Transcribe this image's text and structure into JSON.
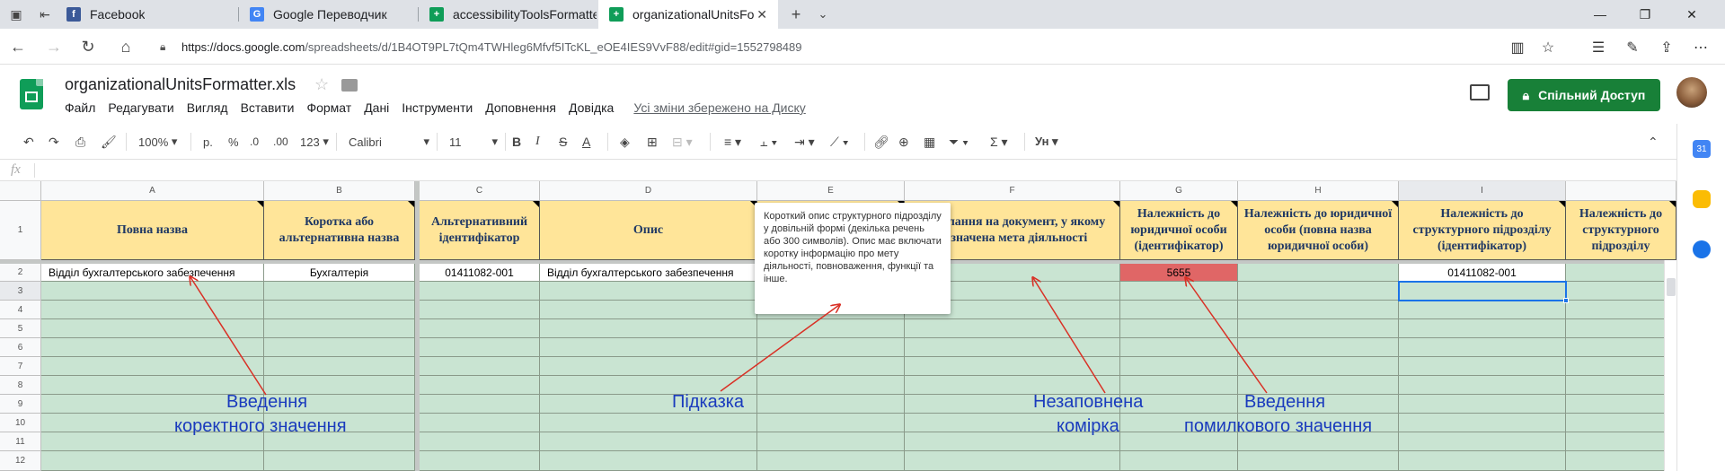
{
  "browser": {
    "tabs": [
      {
        "title": "Facebook",
        "icon": "facebook-icon",
        "color": "#3b5998"
      },
      {
        "title": "Google Переводчик",
        "icon": "google-translate-icon",
        "color": "#4285f4"
      },
      {
        "title": "accessibilityToolsFormatter.x",
        "icon": "sheets-icon",
        "color": "#0f9d58"
      },
      {
        "title": "organizationalUnitsForm",
        "icon": "sheets-icon",
        "color": "#0f9d58"
      }
    ],
    "url_main": "https://docs.google.com",
    "url_rest": "/spreadsheets/d/1B4OT9PL7tQm4TWHleg6Mfvf5ITcKL_eOE4IES9VvF88/edit#gid=1552798489"
  },
  "doc": {
    "title": "organizationalUnitsFormatter.xls",
    "menu": [
      "Файл",
      "Редагувати",
      "Вигляд",
      "Вставити",
      "Формат",
      "Дані",
      "Інструменти",
      "Доповнення",
      "Довідка"
    ],
    "saved_status": "Усі зміни збережено на Диску",
    "share_label": "Спільний Доступ"
  },
  "toolbar": {
    "zoom": "100%",
    "currency": "р.",
    "percent": "%",
    "dec_less": ".0",
    "dec_more": ".00",
    "format": "123",
    "font": "Calibri",
    "size": "11",
    "bold": "B",
    "italic": "I",
    "strike": "S",
    "textcolor": "A"
  },
  "formula_bar": {
    "fx": "fx"
  },
  "columns": [
    "A",
    "B",
    "C",
    "D",
    "E",
    "F",
    "G",
    "H",
    "I"
  ],
  "rows": [
    "1",
    "2",
    "3",
    "4",
    "5",
    "6",
    "7",
    "8",
    "9",
    "10",
    "11",
    "12"
  ],
  "headers": {
    "A": "Повна назва",
    "B": "Коротка або альтернативна  назва",
    "C": "Альтернативний ідентифікатор",
    "D": "Опис",
    "F": "Посилання на документ, у якому визначена мета діяльності",
    "G": "Належність до юридичної особи (ідентифікатор)",
    "H": "Належність до юридичної особи (повна назва юридичної особи)",
    "I": "Належність до структурного підрозділу (ідентифікатор)",
    "J": "Належність до структурного підрозділу"
  },
  "row2": {
    "A": "Відділ бухгалтерського забезпечення",
    "B": "Бухгалтерія",
    "C": "01411082-001",
    "D": "Відділ бухгалтерського забезпечення",
    "G": "5655",
    "I": "01411082-001"
  },
  "tooltip": "Короткий опис структурного підрозділу у довільній формі (декілька речень або 300 символів). Опис має включати коротку інформацію про мету діяльності, повноваження, функції та інше.",
  "annotations": {
    "correct_1": "Введення",
    "correct_2": "коректного значення",
    "hint": "Підказка",
    "empty_1": "Незаповнена",
    "empty_2": "комірка",
    "wrong_1": "Введення",
    "wrong_2": "помилкового значення"
  },
  "colors": {
    "header_fill": "#ffe599",
    "row_fill": "#c9e4d2",
    "error_fill": "#e06666",
    "annotation": "#1a3bbd",
    "share": "#188038"
  }
}
